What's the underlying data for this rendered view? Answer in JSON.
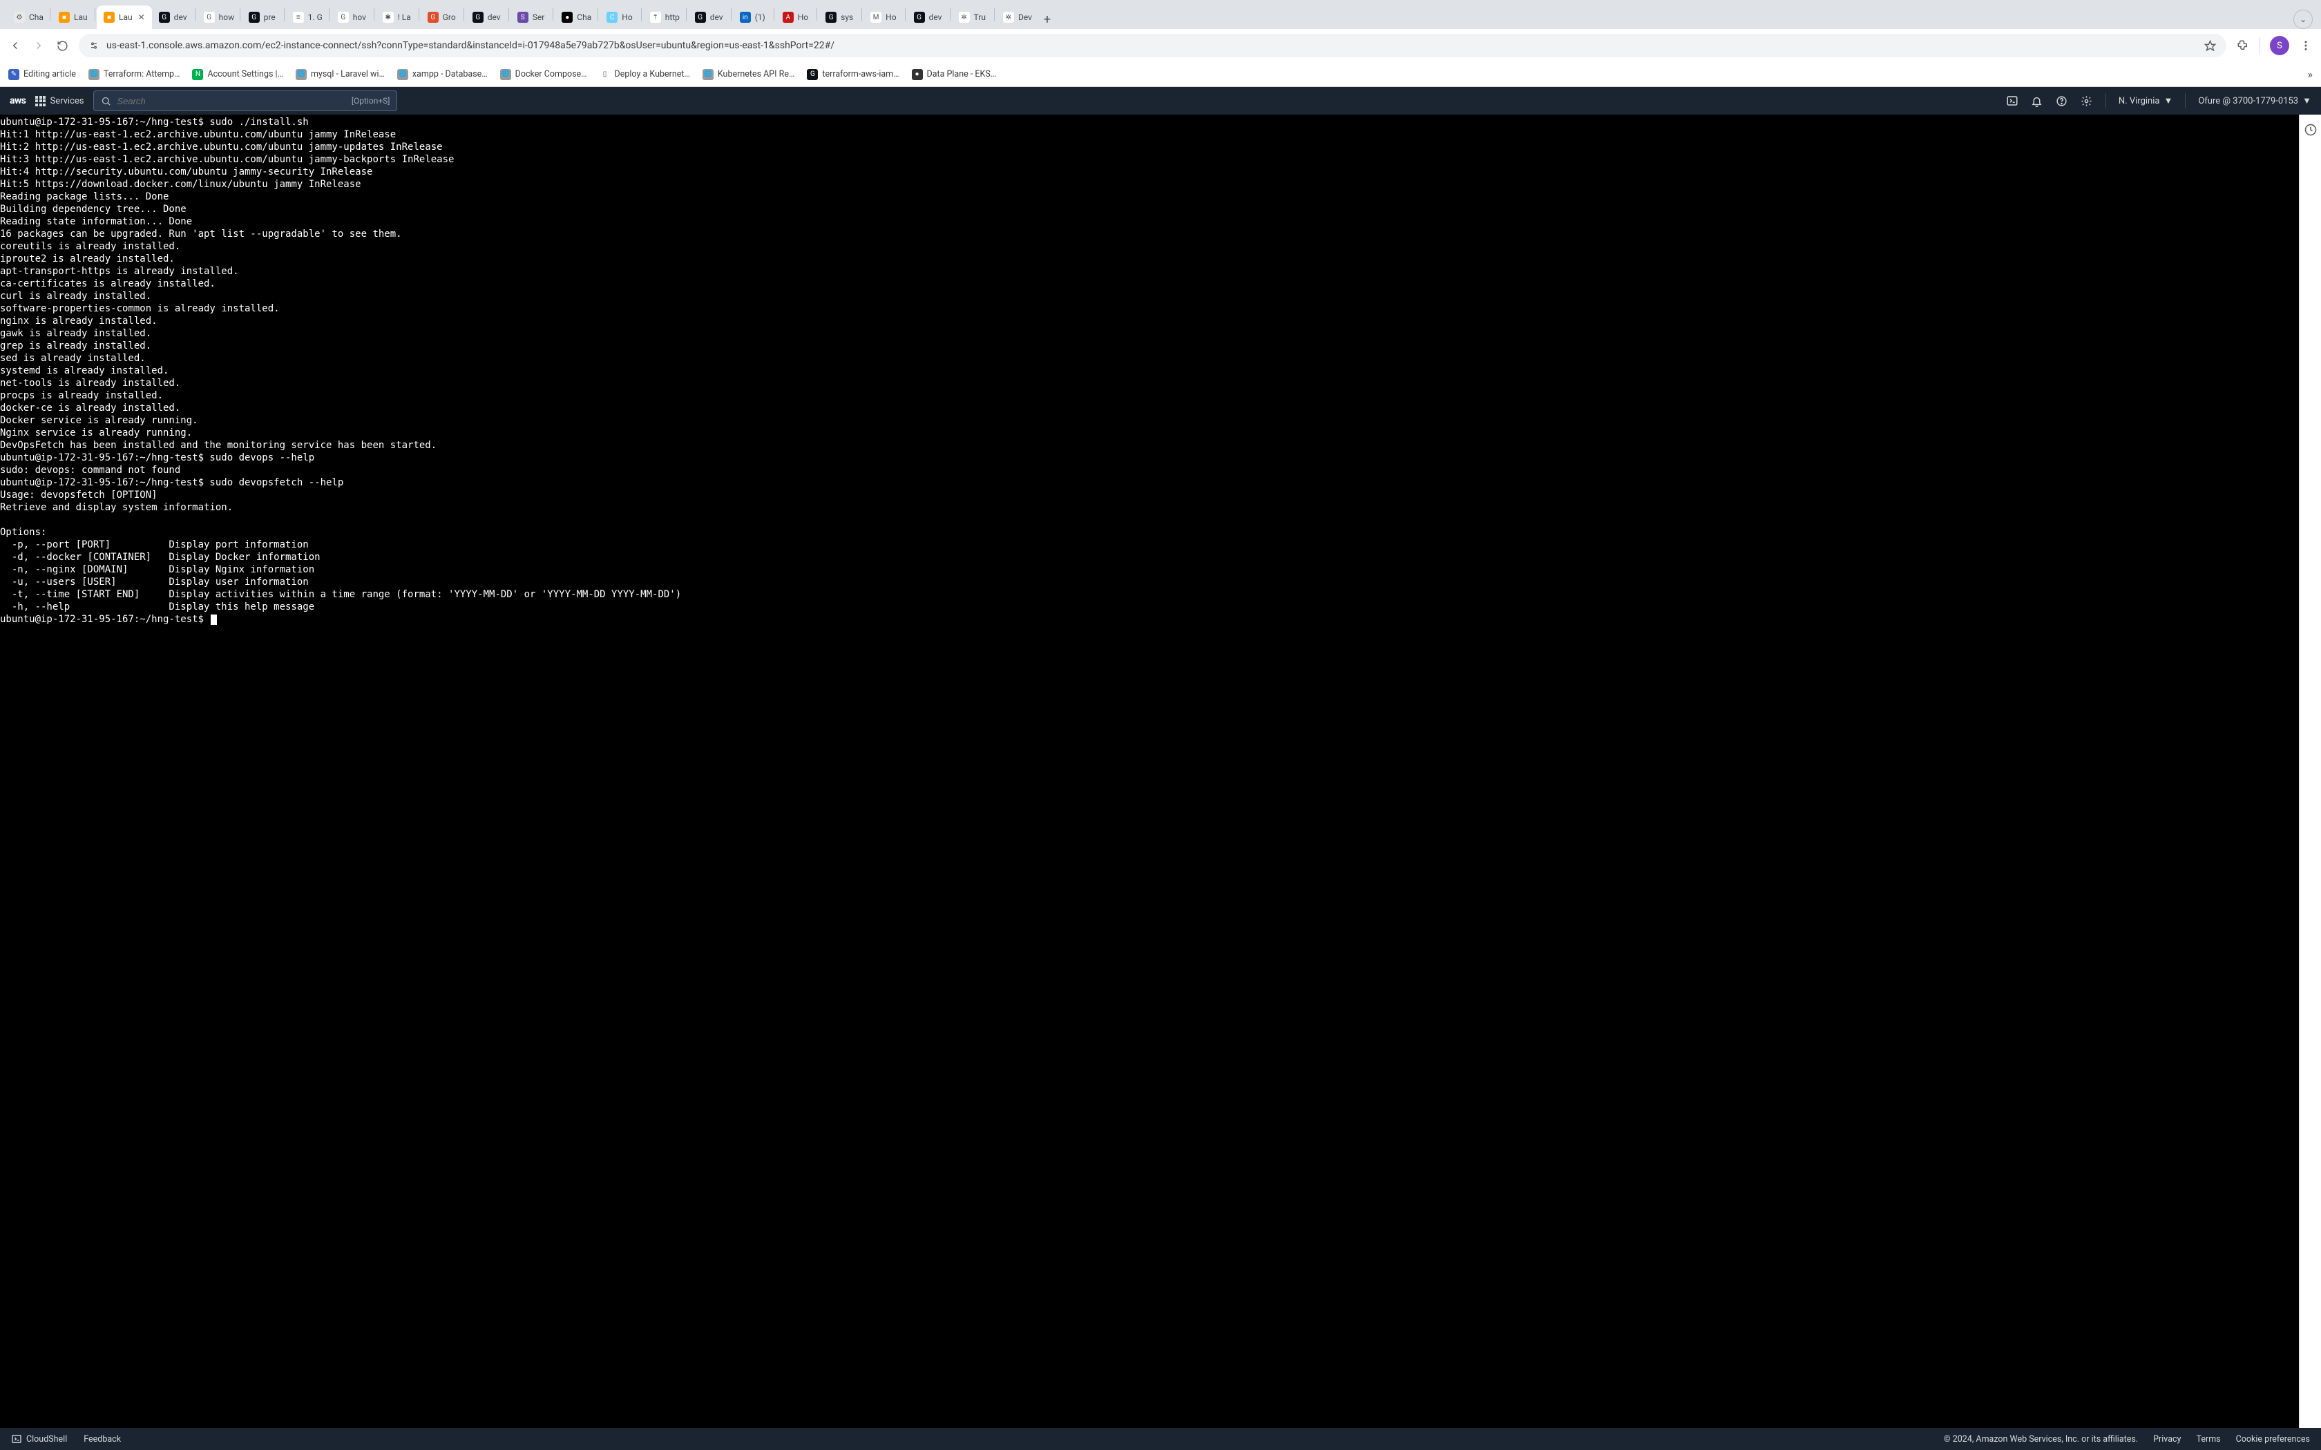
{
  "browser": {
    "tabs": [
      {
        "label": "Cha",
        "favicon_bg": "#e9e9e9",
        "favicon_txt": "⚙"
      },
      {
        "label": "Lau",
        "favicon_bg": "#ff9900",
        "favicon_txt": "■"
      },
      {
        "label": "Lau",
        "favicon_bg": "#ff9900",
        "favicon_txt": "■",
        "active": true
      },
      {
        "label": "dev",
        "favicon_bg": "#0d1117",
        "favicon_txt": "G"
      },
      {
        "label": "how",
        "favicon_bg": "#fff",
        "favicon_txt": "G"
      },
      {
        "label": "pre",
        "favicon_bg": "#0d1117",
        "favicon_txt": "G"
      },
      {
        "label": "1. G",
        "favicon_bg": "#fff",
        "favicon_txt": "≡"
      },
      {
        "label": "hov",
        "favicon_bg": "#fff",
        "favicon_txt": "G"
      },
      {
        "label": "! La",
        "favicon_bg": "#fff",
        "favicon_txt": "✱"
      },
      {
        "label": "Gro",
        "favicon_bg": "#e14d2a",
        "favicon_txt": "G"
      },
      {
        "label": "dev",
        "favicon_bg": "#0d1117",
        "favicon_txt": "G"
      },
      {
        "label": "Ser",
        "favicon_bg": "#6b4aa8",
        "favicon_txt": "S"
      },
      {
        "label": "Cha",
        "favicon_bg": "#000",
        "favicon_txt": "●"
      },
      {
        "label": "Ho",
        "favicon_bg": "#6bd0ff",
        "favicon_txt": "C"
      },
      {
        "label": "http",
        "favicon_bg": "#fff",
        "favicon_txt": "⇡"
      },
      {
        "label": "dev",
        "favicon_bg": "#0d1117",
        "favicon_txt": "G"
      },
      {
        "label": "(1)",
        "favicon_bg": "#0a66c2",
        "favicon_txt": "in"
      },
      {
        "label": "Ho",
        "favicon_bg": "#c81414",
        "favicon_txt": "A"
      },
      {
        "label": "sys",
        "favicon_bg": "#0d1117",
        "favicon_txt": "G"
      },
      {
        "label": "Ho",
        "favicon_bg": "#fff",
        "favicon_txt": "M"
      },
      {
        "label": "dev",
        "favicon_bg": "#0d1117",
        "favicon_txt": "G"
      },
      {
        "label": "Tru",
        "favicon_bg": "#fff",
        "favicon_txt": "✲"
      },
      {
        "label": "Dev",
        "favicon_bg": "#fff",
        "favicon_txt": "✲"
      }
    ],
    "url": "us-east-1.console.aws.amazon.com/ec2-instance-connect/ssh?connType=standard&instanceId=i-017948a5e79ab727b&osUser=ubuntu&region=us-east-1&sshPort=22#/",
    "profile_letter": "S",
    "bookmarks": [
      {
        "label": "Editing article",
        "icon_bg": "#3b62c0",
        "icon_txt": "✎"
      },
      {
        "label": "Terraform: Attemp…",
        "icon_bg": "#999",
        "icon_txt": "🌐"
      },
      {
        "label": "Account Settings |…",
        "icon_bg": "#00b14f",
        "icon_txt": "N"
      },
      {
        "label": "mysql - Laravel wi…",
        "icon_bg": "#999",
        "icon_txt": "🌐"
      },
      {
        "label": "xampp - Database…",
        "icon_bg": "#999",
        "icon_txt": "🌐"
      },
      {
        "label": "Docker Compose…",
        "icon_bg": "#999",
        "icon_txt": "🌐"
      },
      {
        "label": "Deploy a Kubernet…",
        "icon_bg": "#fff",
        "icon_txt": "▯"
      },
      {
        "label": "Kubernetes API Re…",
        "icon_bg": "#999",
        "icon_txt": "🌐"
      },
      {
        "label": "terraform-aws-iam…",
        "icon_bg": "#0d1117",
        "icon_txt": "G"
      },
      {
        "label": "Data Plane - EKS…",
        "icon_bg": "#333",
        "icon_txt": "●"
      }
    ]
  },
  "aws": {
    "logo": "aws",
    "services_label": "Services",
    "search_placeholder": "Search",
    "search_hint": "[Option+S]",
    "region": "N. Virginia",
    "account": "Ofure @ 3700-1779-0153",
    "footer_cloudshell": "CloudShell",
    "footer_feedback": "Feedback",
    "footer_copyright": "© 2024, Amazon Web Services, Inc. or its affiliates.",
    "footer_privacy": "Privacy",
    "footer_terms": "Terms",
    "footer_cookie": "Cookie preferences"
  },
  "terminal": {
    "lines": [
      "ubuntu@ip-172-31-95-167:~/hng-test$ sudo ./install.sh",
      "Hit:1 http://us-east-1.ec2.archive.ubuntu.com/ubuntu jammy InRelease",
      "Hit:2 http://us-east-1.ec2.archive.ubuntu.com/ubuntu jammy-updates InRelease",
      "Hit:3 http://us-east-1.ec2.archive.ubuntu.com/ubuntu jammy-backports InRelease",
      "Hit:4 http://security.ubuntu.com/ubuntu jammy-security InRelease",
      "Hit:5 https://download.docker.com/linux/ubuntu jammy InRelease",
      "Reading package lists... Done",
      "Building dependency tree... Done",
      "Reading state information... Done",
      "16 packages can be upgraded. Run 'apt list --upgradable' to see them.",
      "coreutils is already installed.",
      "iproute2 is already installed.",
      "apt-transport-https is already installed.",
      "ca-certificates is already installed.",
      "curl is already installed.",
      "software-properties-common is already installed.",
      "nginx is already installed.",
      "gawk is already installed.",
      "grep is already installed.",
      "sed is already installed.",
      "systemd is already installed.",
      "net-tools is already installed.",
      "procps is already installed.",
      "docker-ce is already installed.",
      "Docker service is already running.",
      "Nginx service is already running.",
      "DevOpsFetch has been installed and the monitoring service has been started.",
      "ubuntu@ip-172-31-95-167:~/hng-test$ sudo devops --help",
      "sudo: devops: command not found",
      "ubuntu@ip-172-31-95-167:~/hng-test$ sudo devopsfetch --help",
      "Usage: devopsfetch [OPTION]",
      "Retrieve and display system information.",
      "",
      "Options:",
      "  -p, --port [PORT]          Display port information",
      "  -d, --docker [CONTAINER]   Display Docker information",
      "  -n, --nginx [DOMAIN]       Display Nginx information",
      "  -u, --users [USER]         Display user information",
      "  -t, --time [START END]     Display activities within a time range (format: 'YYYY-MM-DD' or 'YYYY-MM-DD YYYY-MM-DD')",
      "  -h, --help                 Display this help message"
    ],
    "prompt": "ubuntu@ip-172-31-95-167:~/hng-test$ "
  }
}
